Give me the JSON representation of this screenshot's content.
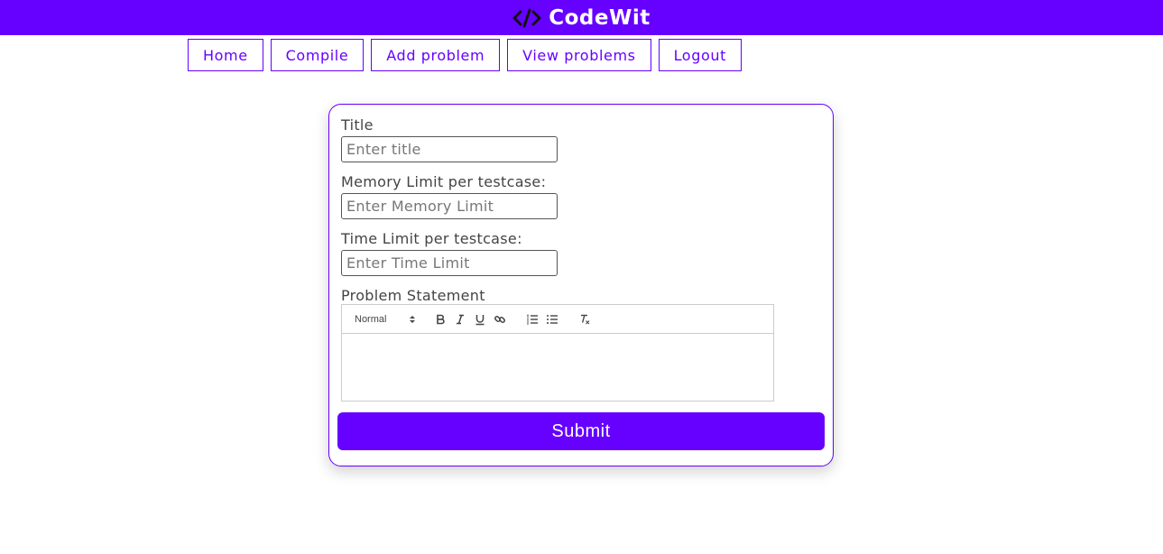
{
  "app": {
    "brand_name": "CodeWit",
    "brand_icon": "code-brackets-icon",
    "accent_color": "#6600ff"
  },
  "nav": {
    "items": [
      {
        "label": "Home"
      },
      {
        "label": "Compile"
      },
      {
        "label": "Add problem"
      },
      {
        "label": "View problems"
      },
      {
        "label": "Logout"
      }
    ]
  },
  "form": {
    "title": {
      "label": "Title",
      "placeholder": "Enter title",
      "value": ""
    },
    "memory": {
      "label": "Memory Limit per testcase:",
      "placeholder": "Enter Memory Limit",
      "value": ""
    },
    "time": {
      "label": "Time Limit per testcase:",
      "placeholder": "Enter Time Limit",
      "value": ""
    },
    "statement": {
      "label": "Problem Statement",
      "toolbar": {
        "header_select": "Normal",
        "buttons": [
          "bold-icon",
          "italic-icon",
          "underline-icon",
          "link-icon",
          "ordered-list-icon",
          "bullet-list-icon",
          "clear-format-icon"
        ]
      },
      "content": ""
    },
    "submit_label": "Submit"
  }
}
